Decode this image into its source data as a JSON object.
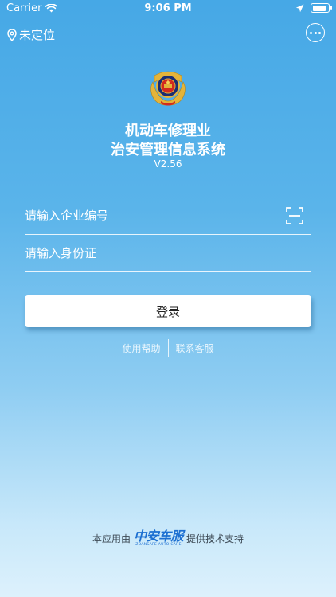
{
  "status_bar": {
    "carrier": "Carrier",
    "time": "9:06 PM"
  },
  "header": {
    "location_label": "未定位"
  },
  "app": {
    "title_line1": "机动车修理业",
    "title_line2": "治安管理信息系统",
    "version": "V2.56"
  },
  "form": {
    "company_placeholder": "请输入企业编号",
    "id_placeholder": "请输入身份证",
    "login_label": "登录"
  },
  "links": {
    "help": "使用帮助",
    "support": "联系客服"
  },
  "footer": {
    "prefix": "本应用由",
    "logo_text": "中安车服",
    "logo_sub": "ZOANSAFE AUTO CARE",
    "suffix": "提供技术支持"
  },
  "colors": {
    "background_top": "#46a8e6",
    "background_bottom": "#ddf1fc",
    "logo_blue": "#1c6fd1"
  }
}
